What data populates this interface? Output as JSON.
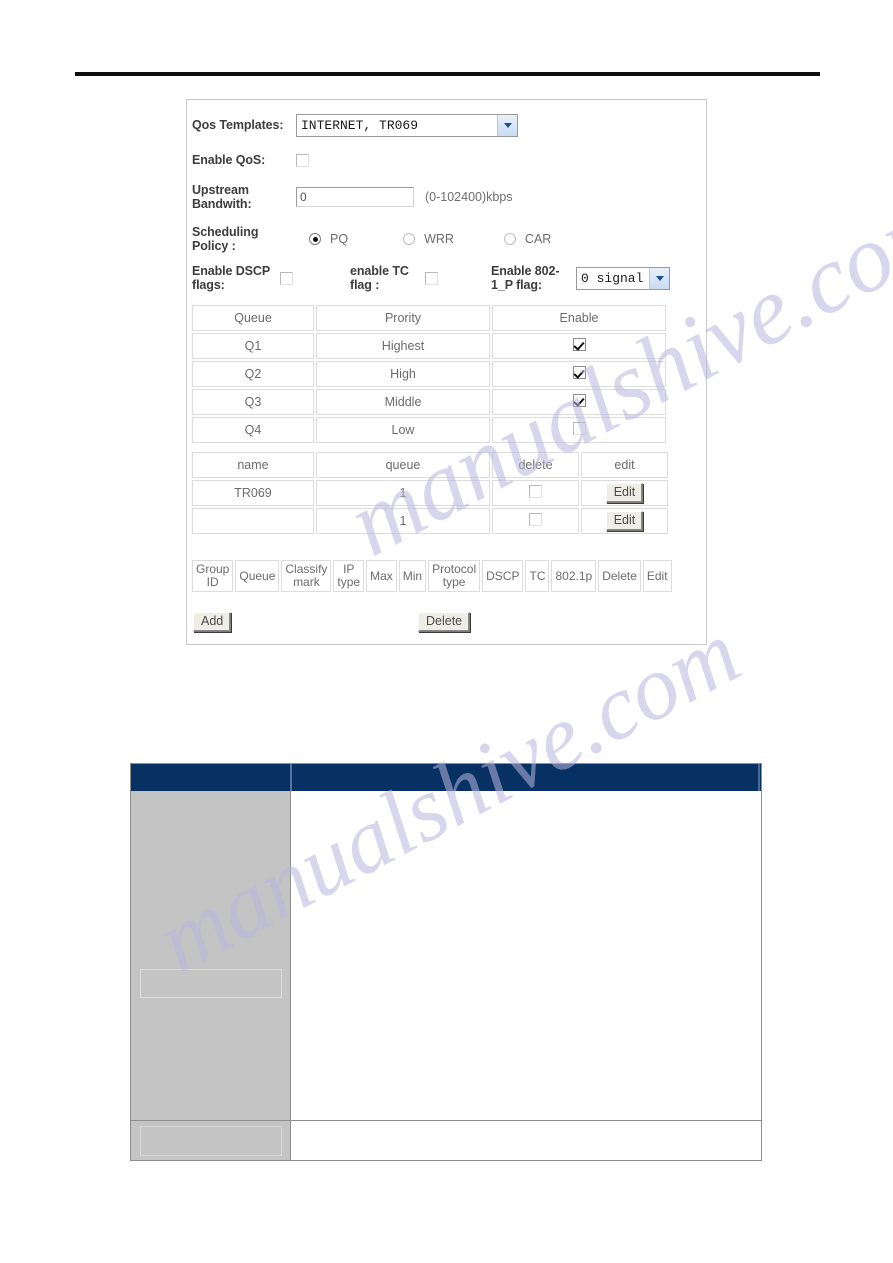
{
  "page": {
    "watermark_text_1": "manualshive.com",
    "watermark_text_2": "manualshive.com"
  },
  "qos_form": {
    "templates_label": "Qos Templates:",
    "templates_value": "INTERNET, TR069",
    "enable_qos_label": "Enable QoS:",
    "enable_qos_checked": false,
    "upstream_label": "Upstream Bandwith:",
    "upstream_value": "0",
    "upstream_hint": "(0-102400)kbps",
    "scheduling_label": "Scheduling Policy :",
    "scheduling_options": [
      {
        "label": "PQ",
        "selected": true
      },
      {
        "label": "WRR",
        "selected": false
      },
      {
        "label": "CAR",
        "selected": false
      }
    ],
    "dscp_label": "Enable DSCP flags:",
    "dscp_checked": false,
    "tc_label": "enable TC flag :",
    "tc_checked": false,
    "dot1p_label": "Enable 802-1_P flag:",
    "dot1p_value": "0 signal"
  },
  "queue_table": {
    "headers": [
      "Queue",
      "Prority",
      "Enable"
    ],
    "rows": [
      {
        "queue": "Q1",
        "priority": "Highest",
        "enabled": true
      },
      {
        "queue": "Q2",
        "priority": "High",
        "enabled": true
      },
      {
        "queue": "Q3",
        "priority": "Middle",
        "enabled": true
      },
      {
        "queue": "Q4",
        "priority": "Low",
        "enabled": false
      }
    ]
  },
  "rule_table": {
    "headers": [
      "name",
      "queue",
      "delete",
      "edit"
    ],
    "edit_button_label": "Edit",
    "rows": [
      {
        "name": "TR069",
        "queue": "1",
        "delete_checked": false
      },
      {
        "name": "",
        "queue": "1",
        "delete_checked": false
      }
    ]
  },
  "classify_table": {
    "headers": [
      "Group ID",
      "Queue",
      "Classify mark",
      "IP type",
      "Max",
      "Min",
      "Protocol type",
      "DSCP",
      "TC",
      "802.1p",
      "Delete",
      "Edit"
    ]
  },
  "actions": {
    "add_label": "Add",
    "delete_label": "Delete"
  },
  "colors": {
    "header_blue": "#083163",
    "panel_border": "#c9c9cf",
    "sidebar_gray": "#c4c4c4",
    "grid_border": "#dcdcdc",
    "rule_line": "#0d0d0d"
  }
}
